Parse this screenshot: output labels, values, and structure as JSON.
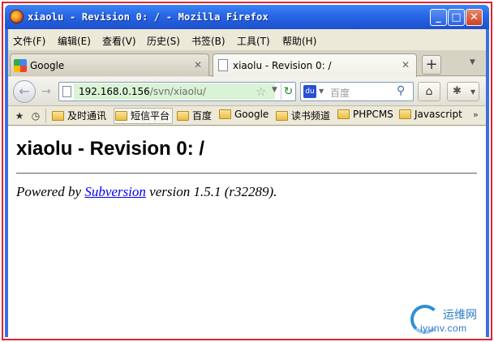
{
  "window": {
    "title": "xiaolu - Revision 0: / - Mozilla Firefox",
    "minimize": "_",
    "maximize": "□",
    "close": "✕"
  },
  "menu": [
    {
      "label": "文件(F)"
    },
    {
      "label": "编辑(E)"
    },
    {
      "label": "查看(V)"
    },
    {
      "label": "历史(S)"
    },
    {
      "label": "书签(B)"
    },
    {
      "label": "工具(T)"
    },
    {
      "label": "帮助(H)"
    }
  ],
  "tabs": [
    {
      "label": "Google",
      "icon": "google-favicon-icon",
      "active": false
    },
    {
      "label": "xiaolu - Revision 0: /",
      "icon": "page-icon",
      "active": true
    }
  ],
  "tab_close": "✕",
  "new_tab": "+",
  "navigation": {
    "url_host": "192.168.0.156",
    "url_path": "/svn/xiaolu/",
    "search_placeholder": "百度",
    "search_engine_icon": "baidu-icon"
  },
  "bookmarks": [
    {
      "label": "及时通讯"
    },
    {
      "label": "短信平台"
    },
    {
      "label": "百度"
    },
    {
      "label": "Google"
    },
    {
      "label": "读书频道"
    },
    {
      "label": "PHPCMS"
    },
    {
      "label": "Javascript"
    }
  ],
  "bookmarks_more": "»",
  "content": {
    "heading": "xiaolu - Revision 0: /",
    "powered_prefix": "Powered by ",
    "powered_link": "Subversion",
    "powered_suffix": " version 1.5.1 (r32289)."
  },
  "watermark": {
    "cn": "运维网",
    "en": "iyunv.com"
  },
  "colors": {
    "titlebar": "#2a68e8",
    "link": "#0000ee",
    "url_highlight": "#daf3d4"
  }
}
